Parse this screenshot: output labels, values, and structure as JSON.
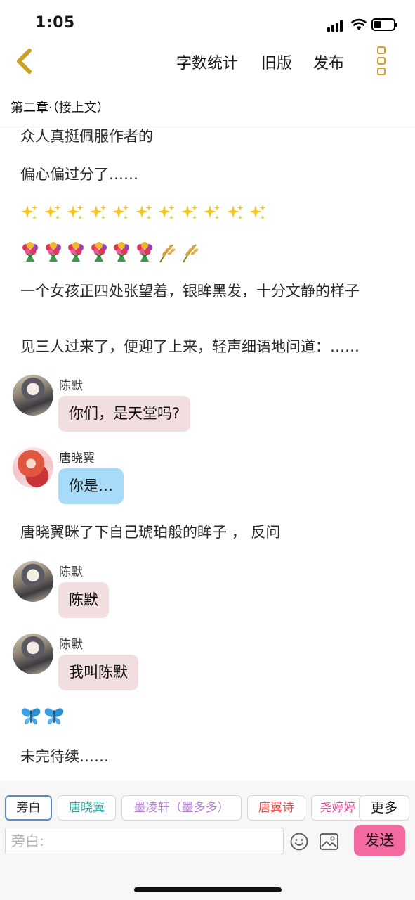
{
  "status_bar": {
    "time": "1:05"
  },
  "nav": {
    "word_count": "字数统计",
    "old_version": "旧版",
    "publish": "发布"
  },
  "chapter": {
    "title": "第二章·（接上文）"
  },
  "content": {
    "paragraphs": [
      "众人真挺佩服作者的",
      "偏心偏过分了……",
      "一个女孩正四处张望着，银眸黑发，十分文静的样子",
      "见三人过来了，便迎了上来，轻声细语地问道：……",
      "唐晓翼眯了下自己琥珀般的眸子 ， 反问",
      "未完待续……"
    ],
    "emoji_rows": [
      {
        "icon": "sparkles-icon",
        "count": 11
      },
      {
        "icons": [
          "bouquet-icon",
          "bouquet-icon",
          "bouquet-icon",
          "bouquet-icon",
          "bouquet-icon",
          "bouquet-icon",
          "rice-ear-icon",
          "rice-ear-icon"
        ]
      },
      {
        "icon": "butterfly-icon",
        "count": 2
      }
    ],
    "messages": [
      {
        "speaker": "陈默",
        "text": "你们，是天堂吗?",
        "bubble_color": "#f2dede"
      },
      {
        "speaker": "唐晓翼",
        "text": "你是…",
        "bubble_color": "#a8dbf7"
      },
      {
        "speaker": "陈默",
        "text": "陈默",
        "bubble_color": "#f2dede"
      },
      {
        "speaker": "陈默",
        "text": "我叫陈默",
        "bubble_color": "#f2dede"
      }
    ]
  },
  "composer": {
    "roles": [
      {
        "label": "旁白",
        "color": "#222222",
        "active": true
      },
      {
        "label": "唐晓翼",
        "color": "#3aa8a0"
      },
      {
        "label": "墨凌轩（墨多多）",
        "color": "#b57fd1"
      },
      {
        "label": "唐翼诗",
        "color": "#e0554f"
      },
      {
        "label": "尧婷婷",
        "color": "#e24f9a"
      }
    ],
    "more_label": "更多",
    "input_placeholder": "旁白:",
    "send_label": "发送",
    "send_color": "#f36aa0"
  }
}
